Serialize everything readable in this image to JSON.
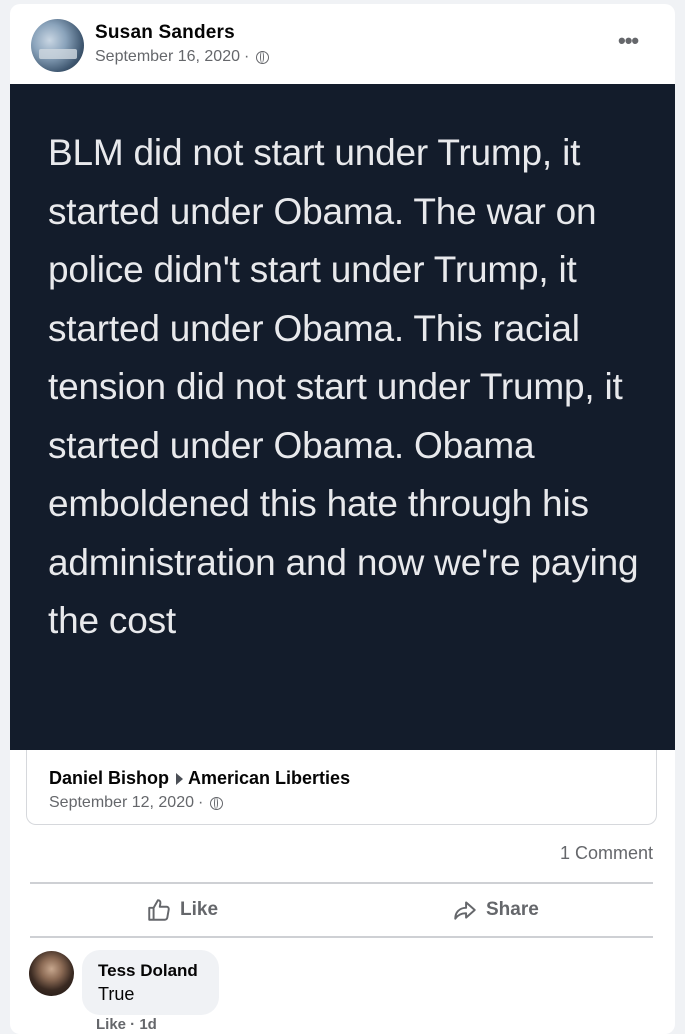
{
  "post": {
    "author": "Susan Sanders",
    "date": "September 16, 2020",
    "separator": "·",
    "more_label": "•••"
  },
  "image_text": "BLM did not start under Trump, it started under Obama. The war on police didn't start under Trump, it started under Obama. This racial tension did not start under Trump, it started under Obama. Obama emboldened this hate through his administration and now we're paying the cost",
  "shared": {
    "author": "Daniel Bishop",
    "group": "American Liberties",
    "date": "September 12, 2020",
    "separator": "·"
  },
  "stats": {
    "comment_count": "1 Comment"
  },
  "actions": {
    "like": "Like",
    "share": "Share"
  },
  "comment": {
    "author": "Tess Doland",
    "text": "True",
    "actions": "Like · 1d"
  },
  "colors": {
    "image_bg": "#131c2b",
    "secondary_text": "#65676b"
  },
  "icons": [
    "globe-icon",
    "more-icon",
    "like-icon",
    "share-icon"
  ]
}
